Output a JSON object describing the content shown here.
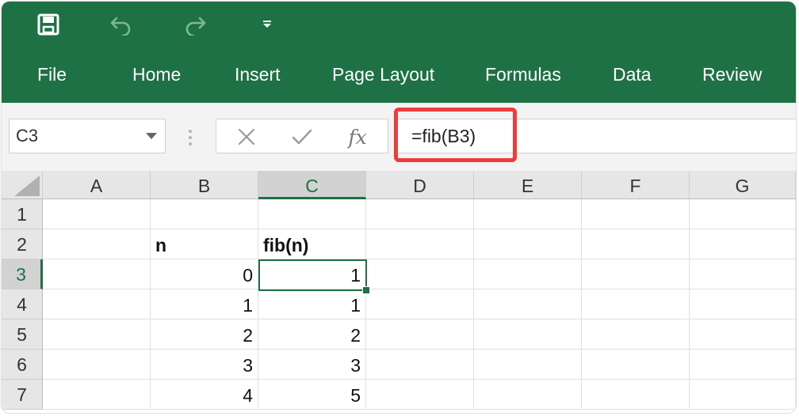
{
  "menu": {
    "tabs": [
      {
        "label": "File"
      },
      {
        "label": "Home"
      },
      {
        "label": "Insert"
      },
      {
        "label": "Page Layout"
      },
      {
        "label": "Formulas"
      },
      {
        "label": "Data"
      },
      {
        "label": "Review"
      }
    ]
  },
  "icons": {
    "save": "save-icon",
    "undo": "undo-icon",
    "redo": "redo-icon",
    "customize": "dropdown-arrow-icon",
    "cancel": "close-icon",
    "enter": "checkmark-icon",
    "fx": "function-icon"
  },
  "formula_bar": {
    "name_box": "C3",
    "fx_label": "fx",
    "formula": "=fib(B3)"
  },
  "sheet": {
    "columns": [
      "A",
      "B",
      "C",
      "D",
      "E",
      "F",
      "G"
    ],
    "rows": [
      "1",
      "2",
      "3",
      "4",
      "5",
      "6",
      "7"
    ],
    "selected_cell": "C3",
    "cells": {
      "B2": "n",
      "C2": "fib(n)",
      "B3": "0",
      "C3": "1",
      "B4": "1",
      "C4": "1",
      "B5": "2",
      "C5": "2",
      "B6": "3",
      "C6": "3",
      "B7": "4",
      "C7": "5"
    }
  },
  "colors": {
    "ribbon": "#1e7145",
    "highlight": "#ee3b3b",
    "selection": "#1e7145"
  }
}
